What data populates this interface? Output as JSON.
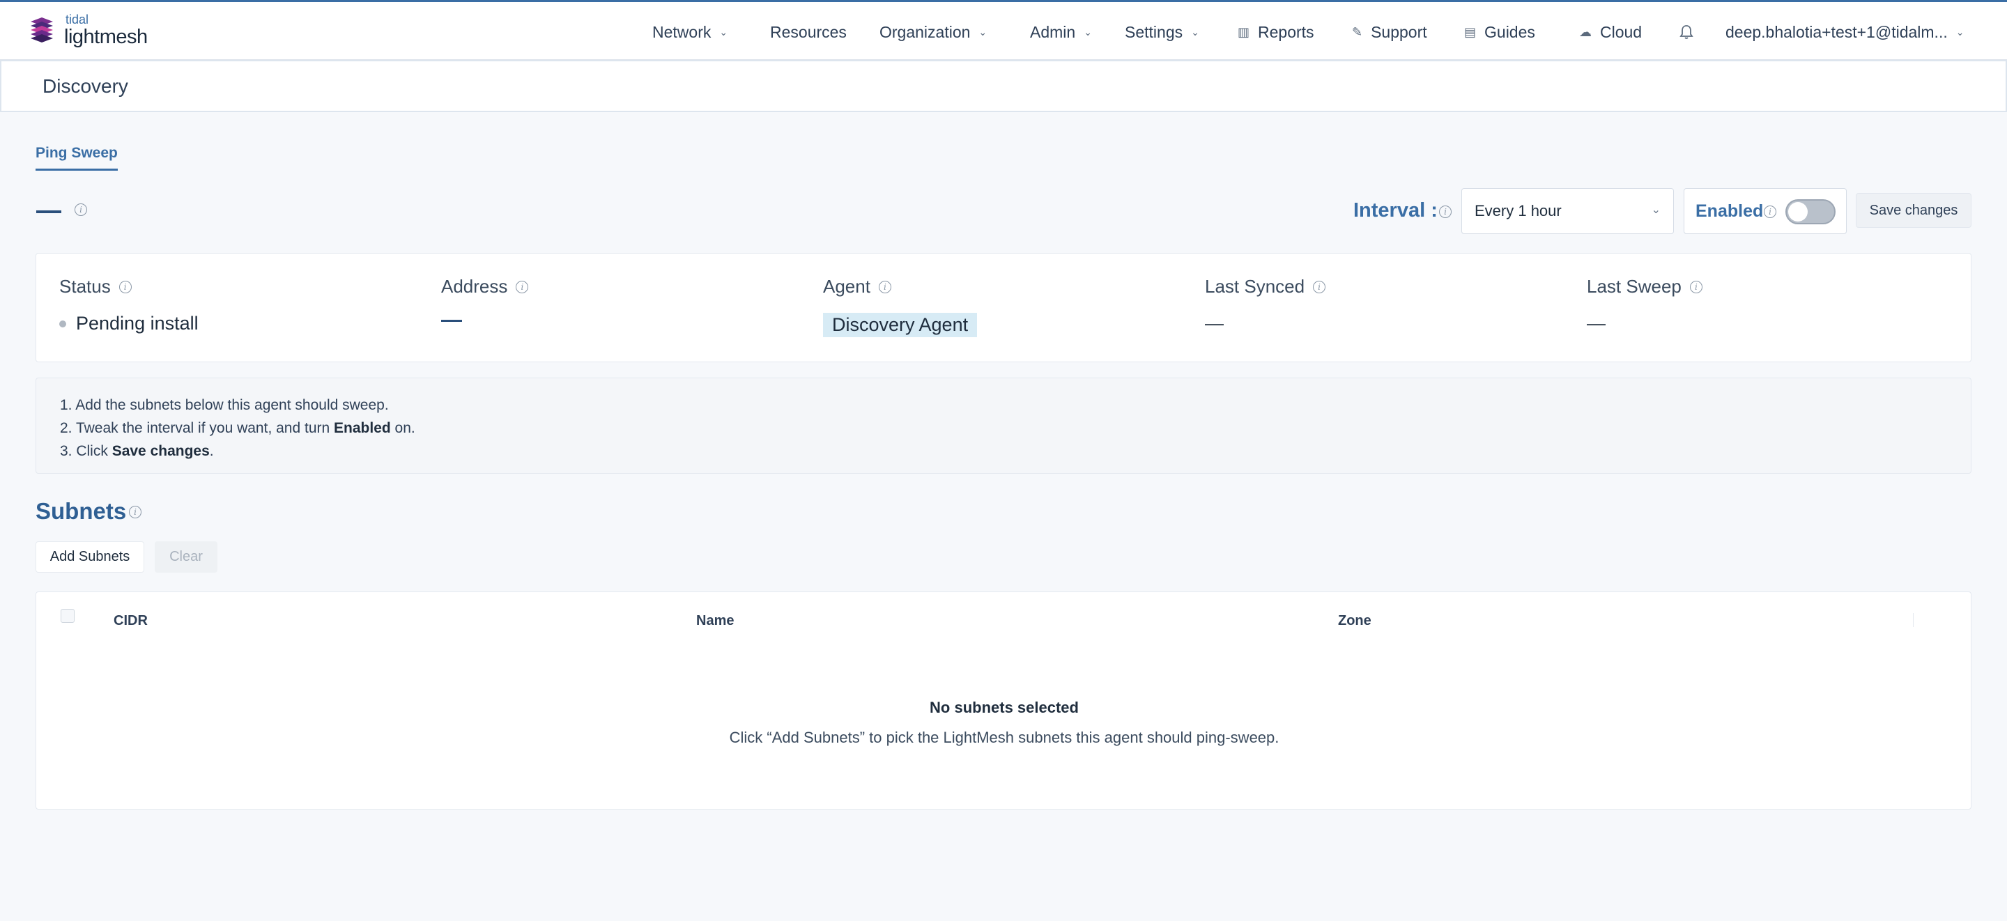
{
  "brand": {
    "small": "tidal",
    "big": "lightmesh"
  },
  "nav": {
    "network": "Network",
    "resources": "Resources",
    "organization": "Organization",
    "admin": "Admin",
    "settings": "Settings",
    "reports": "Reports",
    "support": "Support",
    "guides": "Guides",
    "cloud": "Cloud",
    "user": "deep.bhalotia+test+1@tidalm..."
  },
  "page": {
    "title": "Discovery"
  },
  "tabs": {
    "ping_sweep": "Ping Sweep"
  },
  "controls": {
    "interval_label": "Interval :",
    "interval_value": "Every 1 hour",
    "enabled_label": "Enabled",
    "enabled": false,
    "save_label": "Save changes"
  },
  "status": {
    "status_label": "Status",
    "status_value": "Pending install",
    "address_label": "Address",
    "agent_label": "Agent",
    "agent_value": "Discovery Agent",
    "last_synced_label": "Last Synced",
    "last_synced_value": "—",
    "last_sweep_label": "Last Sweep",
    "last_sweep_value": "—"
  },
  "instructions": {
    "step1": "1. Add the subnets below this agent should sweep.",
    "step2_pre": "2. Tweak the interval if you want, and turn ",
    "step2_bold": "Enabled",
    "step2_post": " on.",
    "step3_pre": "3. Click ",
    "step3_bold": "Save changes",
    "step3_post": "."
  },
  "subnets": {
    "title": "Subnets",
    "add_label": "Add Subnets",
    "clear_label": "Clear",
    "columns": [
      "CIDR",
      "Name",
      "Zone"
    ],
    "empty_title": "No subnets selected",
    "empty_desc": "Click “Add Subnets” to pick the LightMesh subnets this agent should ping-sweep."
  },
  "colors": {
    "accent": "#3a6ea5",
    "badge": "#d7ebf5"
  }
}
